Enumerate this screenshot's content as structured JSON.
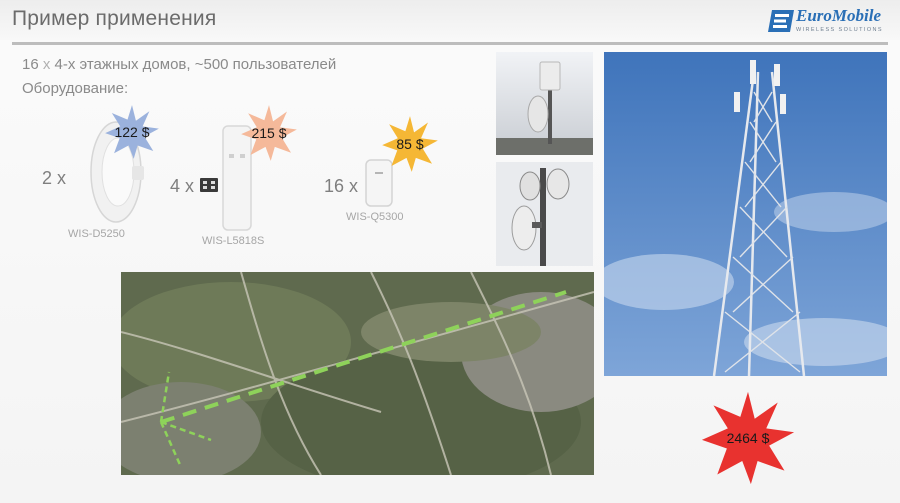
{
  "slide": {
    "title": "Пример применения",
    "line1_count": "16",
    "line1_x": "x",
    "line1_rest": "4-х этажных домов, ~500 пользователей",
    "line2": "Оборудование:"
  },
  "logo": {
    "name": "EuroMobile",
    "tagline": "WIRELESS SOLUTIONS"
  },
  "equipment": [
    {
      "qty": "2 x",
      "model": "WIS-D5250",
      "price": "122 $",
      "burst_color": "#9bb2dd"
    },
    {
      "qty": "4 x",
      "model": "WIS-L5818S",
      "price": "215 $",
      "burst_color": "#f5b99a"
    },
    {
      "qty": "16 x",
      "model": "WIS-Q5300",
      "price": "85 $",
      "burst_color": "#f5b735"
    }
  ],
  "total": {
    "price": "2464 $",
    "burst_color": "#e8322f"
  },
  "colors": {
    "title_gray": "#6b6b6b",
    "logo_blue": "#2a6fb6",
    "link_dash": "#8ed25a",
    "sky": "#4f84c6"
  }
}
